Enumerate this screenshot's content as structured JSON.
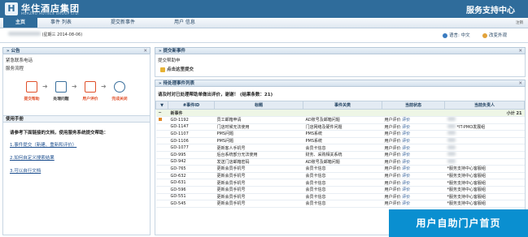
{
  "header": {
    "logo_mark": "H",
    "logo_cn": "华住酒店集团",
    "logo_en": "HUAZHU HOTELS GROUP LTD.",
    "portal_title": "服务支持中心",
    "logout": "注销"
  },
  "nav": {
    "items": [
      {
        "label": "主页",
        "active": true
      },
      {
        "label": "事件 列表",
        "active": false
      },
      {
        "label": "提交新事件",
        "active": false
      },
      {
        "label": "用户 信息",
        "active": false
      }
    ]
  },
  "userbar": {
    "date": "(星期三  2014-08-06)",
    "language": "语言: 中文",
    "change_password": "改变外观"
  },
  "announcement": {
    "title": "公告",
    "items": [
      "紧急联系电话",
      "服务流程"
    ],
    "flow_steps": [
      {
        "label": "提交帮助",
        "color": "#e0502a"
      },
      {
        "label": "处理问题",
        "color": "#333333"
      },
      {
        "label": "用户评价",
        "color": "#e0502a"
      },
      {
        "label": "完成关闭",
        "color": "#e0502a"
      }
    ]
  },
  "manual": {
    "title": "使用手册",
    "note": "请参考下面链接的文档，使用服务系统提交帮助：",
    "links": [
      "1.事件提交（新建、重新和评价）",
      "2.如何自定义搜索结果",
      "3.可以自行文档"
    ]
  },
  "submit_panel": {
    "title": "提交新事件",
    "subtitle": "提交帮助申",
    "link": "点击这里提交"
  },
  "pending": {
    "title": "待处理事件列表",
    "notice": "请及时对已处理帮助单做出评价，谢谢！ (结果条数：21)",
    "columns": [
      "",
      "#事件ID",
      "标题",
      "事件关类",
      "当前状态",
      "当前负责人"
    ],
    "group_label": "新事件",
    "subtotal": "小计 21",
    "rows": [
      {
        "flag": true,
        "id": "GD-1192",
        "title": "员工邮箱申请",
        "category": "AD账号及邮箱问题",
        "status": "用户评价",
        "action": "评价",
        "owner": "",
        "owner_blur": true
      },
      {
        "flag": false,
        "id": "GD-1147",
        "title": "门店时候无法使用",
        "category": "门店网络及硬件问题",
        "status": "用户评价",
        "action": "评价",
        "owner": "*IT-PMO发展组",
        "owner_blur": true
      },
      {
        "flag": false,
        "id": "GD-1107",
        "title": "PMS问题",
        "category": "PMS系统",
        "status": "用户评价",
        "action": "评价",
        "owner": "",
        "owner_blur": true
      },
      {
        "flag": false,
        "id": "GD-1106",
        "title": "PMS问题",
        "category": "PMS系统",
        "status": "用户评价",
        "action": "评价",
        "owner": "",
        "owner_blur": true
      },
      {
        "flag": false,
        "id": "GD-1077",
        "title": "更新客人手机号",
        "category": "会员卡信息",
        "status": "用户评价",
        "action": "评价",
        "owner": "",
        "owner_blur": true
      },
      {
        "flag": false,
        "id": "GD-995",
        "title": "后台系统部分无法使用",
        "category": "财务、采购相关系统",
        "status": "用户评价",
        "action": "评价",
        "owner": "",
        "owner_blur": true
      },
      {
        "flag": false,
        "id": "GD-942",
        "title": "发送门店邮箱密码",
        "category": "AD账号及邮箱问题",
        "status": "用户评价",
        "action": "评价",
        "owner": "",
        "owner_blur": true
      },
      {
        "flag": false,
        "id": "GD-765",
        "title": "更新会员手机号",
        "category": "会员卡信息",
        "status": "用户评价",
        "action": "评价",
        "owner": "*服务支持中心客服组",
        "owner_blur": false
      },
      {
        "flag": false,
        "id": "GD-632",
        "title": "更新会员手机号",
        "category": "会员卡信息",
        "status": "用户评价",
        "action": "评价",
        "owner": "*服务支持中心客服组",
        "owner_blur": false
      },
      {
        "flag": false,
        "id": "GD-631",
        "title": "更新会员手机号",
        "category": "会员卡信息",
        "status": "用户评价",
        "action": "评价",
        "owner": "*服务支持中心客服组",
        "owner_blur": false
      },
      {
        "flag": false,
        "id": "GD-596",
        "title": "更新会员手机号",
        "category": "会员卡信息",
        "status": "用户评价",
        "action": "评价",
        "owner": "*服务支持中心客服组",
        "owner_blur": false
      },
      {
        "flag": false,
        "id": "GD-551",
        "title": "更新会员手机号",
        "category": "会员卡信息",
        "status": "用户评价",
        "action": "评价",
        "owner": "*服务支持中心客服组",
        "owner_blur": false
      },
      {
        "flag": false,
        "id": "GD-545",
        "title": "更新会员手机号",
        "category": "会员卡信息",
        "status": "用户评价",
        "action": "评价",
        "owner": "*服务支持中心客服组",
        "owner_blur": false
      }
    ]
  },
  "watermark": "用户自助门户首页"
}
